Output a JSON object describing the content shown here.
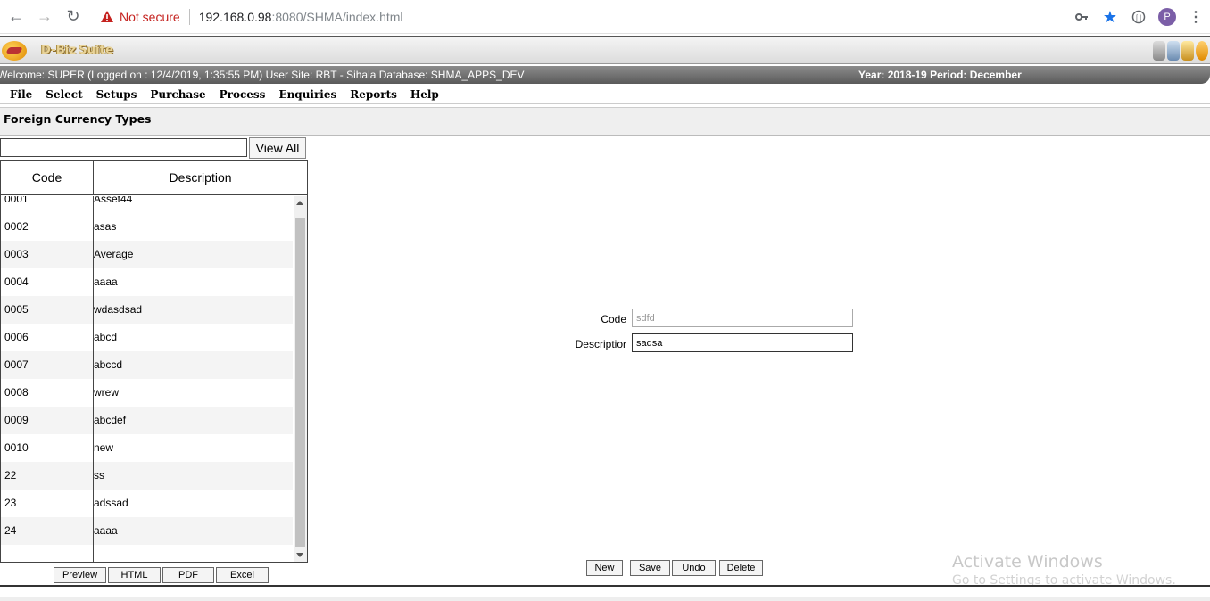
{
  "browser": {
    "security_label": "Not secure",
    "url_host": "192.168.0.98",
    "url_rest": ":8080/SHMA/index.html",
    "avatar_letter": "P"
  },
  "app": {
    "suite_name": "D-Biz Suite",
    "welcome_text": "Welcome: SUPER (Logged on : 12/4/2019, 1:35:55 PM) User Site: RBT - Sihala Database: SHMA_APPS_DEV",
    "period_text": "Year: 2018-19 Period: December"
  },
  "menu": [
    "File",
    "Select",
    "Setups",
    "Purchase",
    "Process",
    "Enquiries",
    "Reports",
    "Help"
  ],
  "page_title": "Foreign Currency Types",
  "list": {
    "search_value": "",
    "view_all_label": "View All",
    "headers": {
      "code": "Code",
      "description": "Description"
    },
    "rows": [
      {
        "code": "0001",
        "description": "Asset44"
      },
      {
        "code": "0002",
        "description": "asas"
      },
      {
        "code": "0003",
        "description": "Average"
      },
      {
        "code": "0004",
        "description": "aaaa"
      },
      {
        "code": "0005",
        "description": "wdasdsad"
      },
      {
        "code": "0006",
        "description": "abcd"
      },
      {
        "code": "0007",
        "description": "abccd"
      },
      {
        "code": "0008",
        "description": "wrew"
      },
      {
        "code": "0009",
        "description": "abcdef"
      },
      {
        "code": "0010",
        "description": "new"
      },
      {
        "code": "22",
        "description": "ss"
      },
      {
        "code": "23",
        "description": "adssad"
      },
      {
        "code": "24",
        "description": "aaaa"
      }
    ]
  },
  "export_buttons": [
    "Preview",
    "HTML",
    "PDF",
    "Excel"
  ],
  "form": {
    "code_label": "Code",
    "code_value": "sdfd",
    "description_label": "Descriptior",
    "description_value": "sadsa"
  },
  "actions": [
    "New",
    "Save",
    "Undo",
    "Delete"
  ],
  "watermark": {
    "line1": "Activate Windows",
    "line2": "Go to Settings to activate Windows."
  }
}
